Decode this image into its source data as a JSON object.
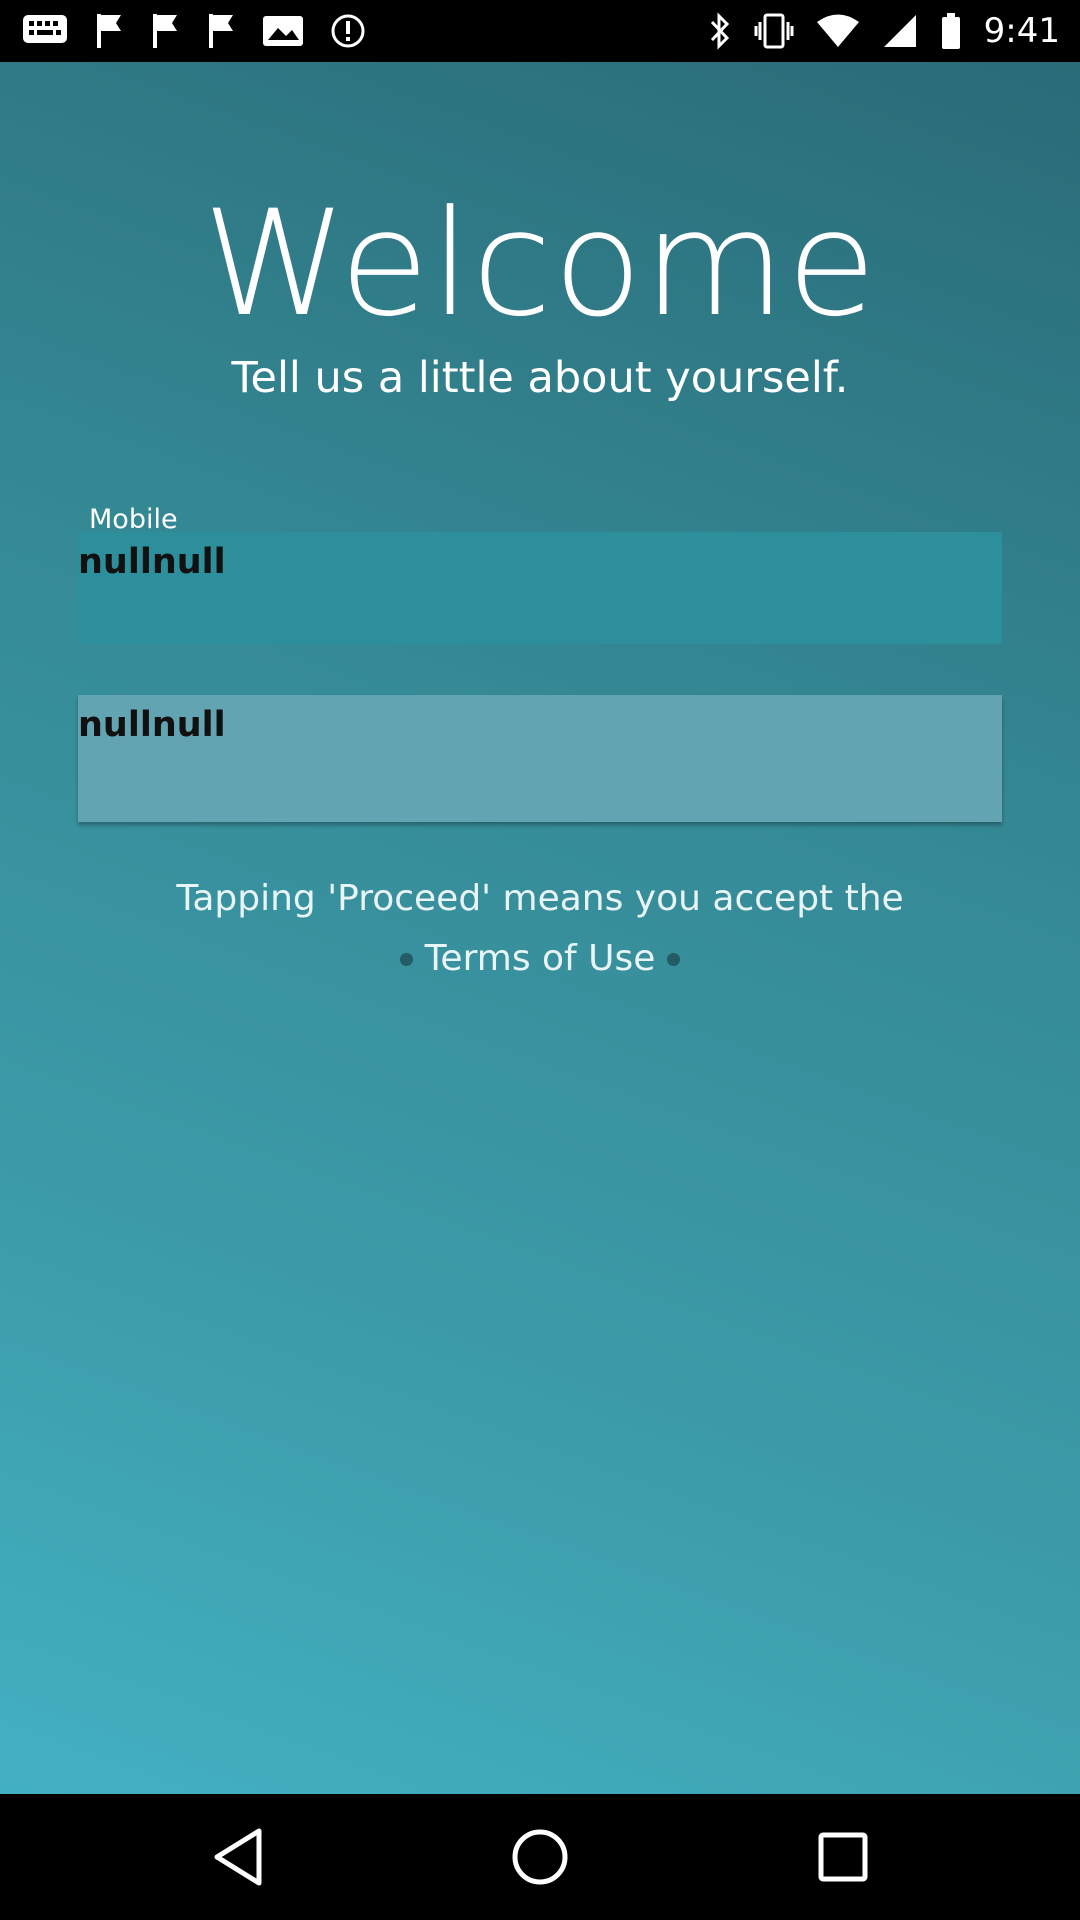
{
  "status_bar": {
    "time": "9:41",
    "left_icons": [
      "message-icon",
      "flag-icon",
      "flag-icon",
      "flag-icon",
      "photo-icon",
      "alert-icon"
    ],
    "right_icons": [
      "bluetooth-icon",
      "vibrate-icon",
      "wifi-icon",
      "signal-icon",
      "battery-icon"
    ]
  },
  "header": {
    "title": "Welcome",
    "subtitle": "Tell us a little about yourself."
  },
  "form": {
    "mobile_label": "Mobile",
    "mobile_value": "nullnull",
    "second_value": "nullnull"
  },
  "consent": {
    "text": "Tapping 'Proceed' means you accept the",
    "terms_link": "Terms of Use"
  },
  "nav": {
    "icons": [
      "back-icon",
      "home-icon",
      "recents-icon"
    ]
  },
  "colors": {
    "background_top": "#2a6b78",
    "background_bottom": "#43b0c2",
    "mobile_field": "#2e8f9c",
    "second_field": "#62a4b1"
  }
}
